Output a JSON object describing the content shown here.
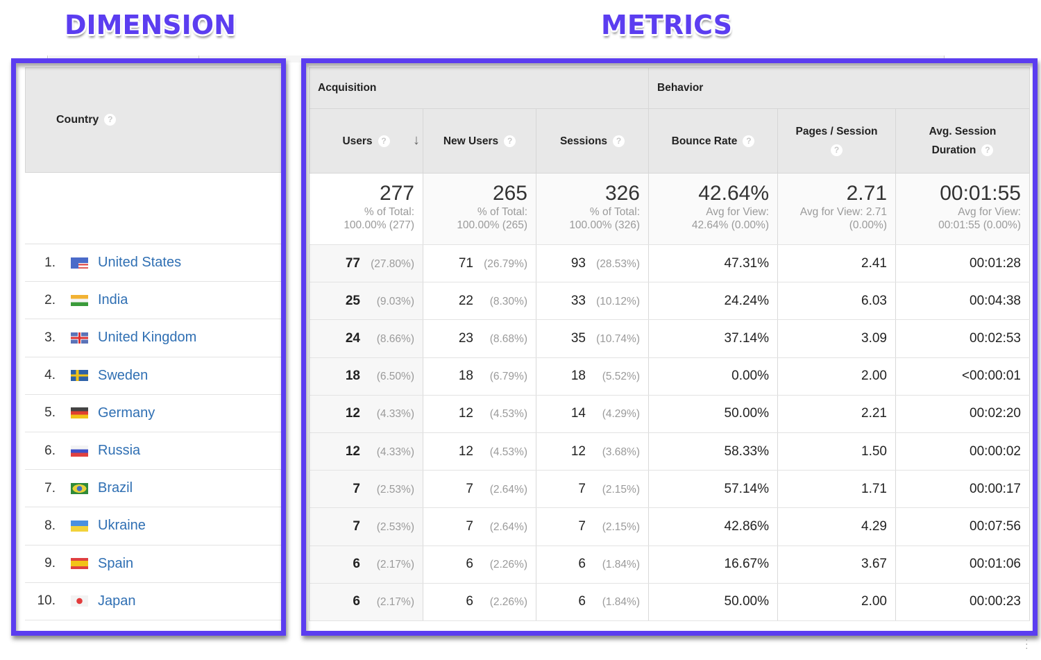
{
  "annotations": {
    "dimension_label": "DIMENSION",
    "metrics_label": "METRICS",
    "highlight_color": "#5b3df0"
  },
  "dimension": {
    "header": "Country",
    "help_icon": "?",
    "rows": [
      {
        "index": "1.",
        "country": "United States",
        "flag": "us-flag-icon"
      },
      {
        "index": "2.",
        "country": "India",
        "flag": "india-flag-icon"
      },
      {
        "index": "3.",
        "country": "United Kingdom",
        "flag": "uk-flag-icon"
      },
      {
        "index": "4.",
        "country": "Sweden",
        "flag": "sweden-flag-icon"
      },
      {
        "index": "5.",
        "country": "Germany",
        "flag": "germany-flag-icon"
      },
      {
        "index": "6.",
        "country": "Russia",
        "flag": "russia-flag-icon"
      },
      {
        "index": "7.",
        "country": "Brazil",
        "flag": "brazil-flag-icon"
      },
      {
        "index": "8.",
        "country": "Ukraine",
        "flag": "ukraine-flag-icon"
      },
      {
        "index": "9.",
        "country": "Spain",
        "flag": "spain-flag-icon"
      },
      {
        "index": "10.",
        "country": "Japan",
        "flag": "japan-flag-icon"
      }
    ]
  },
  "metrics": {
    "groups": [
      "Acquisition",
      "Behavior"
    ],
    "columns": [
      {
        "label": "Users",
        "sorted": true
      },
      {
        "label": "New Users"
      },
      {
        "label": "Sessions"
      },
      {
        "label": "Bounce Rate"
      },
      {
        "label": "Pages / Session"
      },
      {
        "label": "Avg. Session Duration"
      }
    ],
    "sort_icon": "↓",
    "totals": [
      {
        "value": "277",
        "sub1": "% of Total:",
        "sub2": "100.00% (277)"
      },
      {
        "value": "265",
        "sub1": "% of Total:",
        "sub2": "100.00% (265)"
      },
      {
        "value": "326",
        "sub1": "% of Total:",
        "sub2": "100.00% (326)"
      },
      {
        "value": "42.64%",
        "sub1": "Avg for View:",
        "sub2": "42.64% (0.00%)"
      },
      {
        "value": "2.71",
        "sub1": "Avg for View: 2.71",
        "sub2": "(0.00%)"
      },
      {
        "value": "00:01:55",
        "sub1": "Avg for View:",
        "sub2": "00:01:55 (0.00%)"
      }
    ],
    "rows": [
      {
        "users": "77",
        "users_pct": "(27.80%)",
        "new_users": "71",
        "new_users_pct": "(26.79%)",
        "sessions": "93",
        "sessions_pct": "(28.53%)",
        "bounce_rate": "47.31%",
        "pages_session": "2.41",
        "avg_duration": "00:01:28"
      },
      {
        "users": "25",
        "users_pct": "(9.03%)",
        "new_users": "22",
        "new_users_pct": "(8.30%)",
        "sessions": "33",
        "sessions_pct": "(10.12%)",
        "bounce_rate": "24.24%",
        "pages_session": "6.03",
        "avg_duration": "00:04:38"
      },
      {
        "users": "24",
        "users_pct": "(8.66%)",
        "new_users": "23",
        "new_users_pct": "(8.68%)",
        "sessions": "35",
        "sessions_pct": "(10.74%)",
        "bounce_rate": "37.14%",
        "pages_session": "3.09",
        "avg_duration": "00:02:53"
      },
      {
        "users": "18",
        "users_pct": "(6.50%)",
        "new_users": "18",
        "new_users_pct": "(6.79%)",
        "sessions": "18",
        "sessions_pct": "(5.52%)",
        "bounce_rate": "0.00%",
        "pages_session": "2.00",
        "avg_duration": "<00:00:01"
      },
      {
        "users": "12",
        "users_pct": "(4.33%)",
        "new_users": "12",
        "new_users_pct": "(4.53%)",
        "sessions": "14",
        "sessions_pct": "(4.29%)",
        "bounce_rate": "50.00%",
        "pages_session": "2.21",
        "avg_duration": "00:02:20"
      },
      {
        "users": "12",
        "users_pct": "(4.33%)",
        "new_users": "12",
        "new_users_pct": "(4.53%)",
        "sessions": "12",
        "sessions_pct": "(3.68%)",
        "bounce_rate": "58.33%",
        "pages_session": "1.50",
        "avg_duration": "00:00:02"
      },
      {
        "users": "7",
        "users_pct": "(2.53%)",
        "new_users": "7",
        "new_users_pct": "(2.64%)",
        "sessions": "7",
        "sessions_pct": "(2.15%)",
        "bounce_rate": "57.14%",
        "pages_session": "1.71",
        "avg_duration": "00:00:17"
      },
      {
        "users": "7",
        "users_pct": "(2.53%)",
        "new_users": "7",
        "new_users_pct": "(2.64%)",
        "sessions": "7",
        "sessions_pct": "(2.15%)",
        "bounce_rate": "42.86%",
        "pages_session": "4.29",
        "avg_duration": "00:07:56"
      },
      {
        "users": "6",
        "users_pct": "(2.17%)",
        "new_users": "6",
        "new_users_pct": "(2.26%)",
        "sessions": "6",
        "sessions_pct": "(1.84%)",
        "bounce_rate": "16.67%",
        "pages_session": "3.67",
        "avg_duration": "00:01:06"
      },
      {
        "users": "6",
        "users_pct": "(2.17%)",
        "new_users": "6",
        "new_users_pct": "(2.26%)",
        "sessions": "6",
        "sessions_pct": "(1.84%)",
        "bounce_rate": "50.00%",
        "pages_session": "2.00",
        "avg_duration": "00:00:23"
      }
    ]
  }
}
